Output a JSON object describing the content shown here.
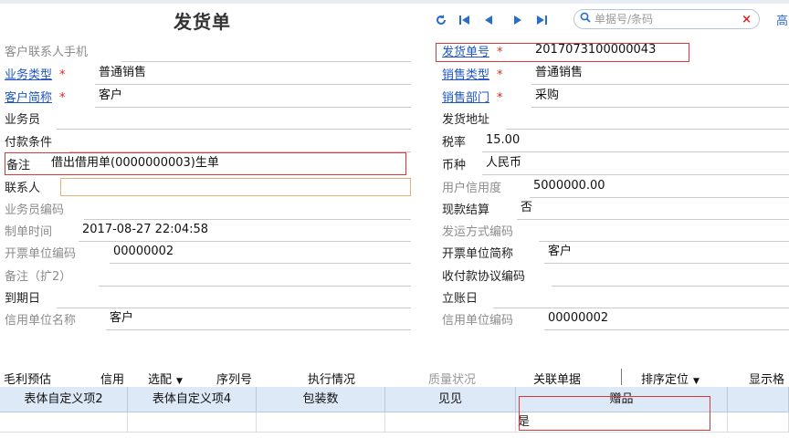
{
  "header": {
    "title": "发货单",
    "search_placeholder": "单据号/条码",
    "right_link": "高"
  },
  "left_fields": [
    {
      "label": "客户联系人手机",
      "value": "",
      "style": "gray",
      "required": false
    },
    {
      "label": "业务类型",
      "value": "普通销售",
      "style": "link",
      "required": true
    },
    {
      "label": "客户简称",
      "value": "客户",
      "style": "link",
      "required": true
    },
    {
      "label": "业务员",
      "value": "",
      "style": "dark",
      "required": false
    },
    {
      "label": "付款条件",
      "value": "",
      "style": "dark",
      "required": false
    },
    {
      "label": "备注",
      "value": "借出借用单(0000000003)生单",
      "style": "dark",
      "required": false
    },
    {
      "label": "联系人",
      "value": "",
      "style": "dark",
      "required": false
    },
    {
      "label": "业务员编码",
      "value": "",
      "style": "gray",
      "required": false
    },
    {
      "label": "制单时间",
      "value": "2017-08-27 22:04:58",
      "style": "gray",
      "required": false
    },
    {
      "label": "开票单位编码",
      "value": "00000002",
      "style": "gray",
      "required": false
    },
    {
      "label": "备注（扩2）",
      "value": "",
      "style": "gray",
      "required": false
    },
    {
      "label": "到期日",
      "value": "",
      "style": "dark",
      "required": false
    },
    {
      "label": "信用单位名称",
      "value": "客户",
      "style": "gray",
      "required": false
    }
  ],
  "right_fields": [
    {
      "label": "发货单号",
      "value": "2017073100000043",
      "style": "link",
      "required": true
    },
    {
      "label": "销售类型",
      "value": "普通销售",
      "style": "link",
      "required": true
    },
    {
      "label": "销售部门",
      "value": "采购",
      "style": "link",
      "required": true
    },
    {
      "label": "发货地址",
      "value": "",
      "style": "dark",
      "required": false
    },
    {
      "label": "税率",
      "value": "15.00",
      "style": "dark",
      "required": false
    },
    {
      "label": "币种",
      "value": "人民币",
      "style": "dark",
      "required": false
    },
    {
      "label": "用户信用度",
      "value": "5000000.00",
      "style": "gray",
      "required": false
    },
    {
      "label": "现款结算",
      "value": "否",
      "style": "dark",
      "required": false
    },
    {
      "label": "发运方式编码",
      "value": "",
      "style": "gray",
      "required": false
    },
    {
      "label": "开票单位简称",
      "value": "客户",
      "style": "dark",
      "required": false
    },
    {
      "label": "收付款协议编码",
      "value": "",
      "style": "dark",
      "required": false
    },
    {
      "label": "立账日",
      "value": "",
      "style": "dark",
      "required": false
    },
    {
      "label": "信用单位编码",
      "value": "00000002",
      "style": "gray",
      "required": false
    }
  ],
  "menu": [
    {
      "label": "毛利预估",
      "dropdown": false,
      "disabled": false
    },
    {
      "label": "信用",
      "dropdown": false,
      "disabled": false
    },
    {
      "label": "选配",
      "dropdown": true,
      "disabled": false
    },
    {
      "label": "序列号",
      "dropdown": false,
      "disabled": false
    },
    {
      "label": "执行情况",
      "dropdown": false,
      "disabled": false
    },
    {
      "label": "质量状况",
      "dropdown": false,
      "disabled": true
    },
    {
      "label": "关联单据",
      "dropdown": false,
      "disabled": false
    },
    {
      "label": "排序定位",
      "dropdown": true,
      "disabled": false
    },
    {
      "label": "显示格",
      "dropdown": false,
      "disabled": false
    }
  ],
  "grid": {
    "columns": [
      "表体自定义项2",
      "表体自定义项4",
      "包装数",
      "见见",
      "赠品",
      ""
    ],
    "rows": [
      [
        "",
        "",
        "",
        "",
        "是",
        ""
      ]
    ]
  },
  "colors": {
    "link": "#1f56c4",
    "required": "#e0261a",
    "highlight_box": "#d83a3a",
    "header_bg": "#dde9f7"
  }
}
